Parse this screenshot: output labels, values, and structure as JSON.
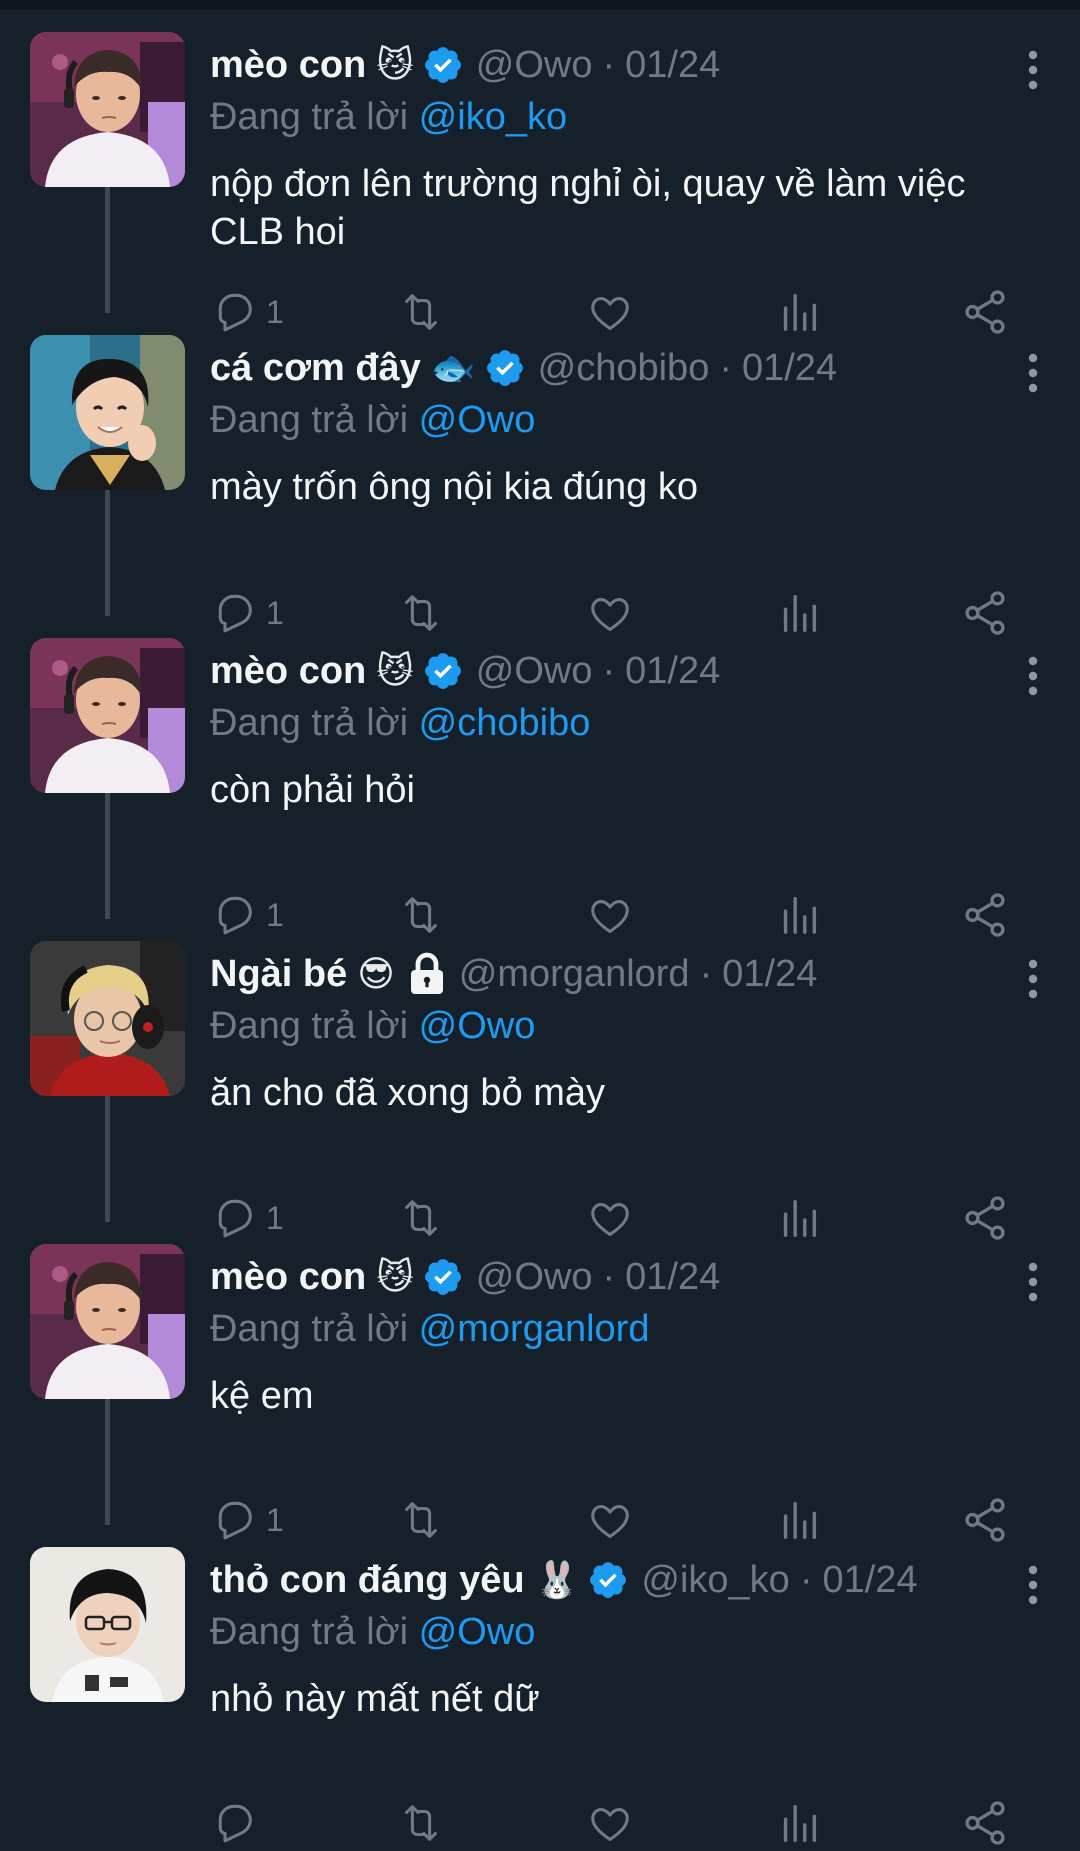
{
  "replying_prefix": "Đang trả lời",
  "tweets": [
    {
      "name": "mèo con",
      "emoji": "😼",
      "verified": true,
      "locked": false,
      "handle": "@Owo",
      "date": "01/24",
      "reply_to": "@iko_ko",
      "text": "nộp đơn lên trường nghỉ òi, quay về làm việc CLB hoi",
      "reply_count": "1",
      "avatar": "meo"
    },
    {
      "name": "cá cơm đây",
      "emoji": "🐟",
      "verified": true,
      "locked": false,
      "handle": "@chobibo",
      "date": "01/24",
      "reply_to": "@Owo",
      "text": "mày trốn ông nội kia đúng ko",
      "reply_count": "1",
      "avatar": "ca"
    },
    {
      "name": "mèo con",
      "emoji": "😼",
      "verified": true,
      "locked": false,
      "handle": "@Owo",
      "date": "01/24",
      "reply_to": "@chobibo",
      "text": "còn phải hỏi",
      "reply_count": "1",
      "avatar": "meo"
    },
    {
      "name": "Ngài bé",
      "emoji": "😎",
      "verified": false,
      "locked": true,
      "handle": "@morganlord",
      "date": "01/24",
      "reply_to": "@Owo",
      "text": "ăn cho đã xong bỏ mày",
      "reply_count": "1",
      "avatar": "ngai"
    },
    {
      "name": "mèo con",
      "emoji": "😼",
      "verified": true,
      "locked": false,
      "handle": "@Owo",
      "date": "01/24",
      "reply_to": "@morganlord",
      "text": "kệ em",
      "reply_count": "1",
      "avatar": "meo"
    },
    {
      "name": "thỏ con đáng yêu",
      "emoji": "🐰",
      "verified": true,
      "locked": false,
      "handle": "@iko_ko",
      "date": "01/24",
      "reply_to": "@Owo",
      "text": "nhỏ này mất nết dữ",
      "reply_count": "",
      "avatar": "tho"
    }
  ],
  "colors": {
    "background": "#15202b",
    "text": "#e7e9ea",
    "muted": "#6e7b87",
    "link": "#1d9bf0",
    "thread_line": "#3d4a56"
  },
  "icons": {
    "reply": "reply-icon",
    "retweet": "retweet-icon",
    "like": "heart-icon",
    "views": "views-icon",
    "share": "share-icon",
    "more": "more-icon",
    "verified": "verified-badge-icon",
    "lock": "lock-icon"
  }
}
